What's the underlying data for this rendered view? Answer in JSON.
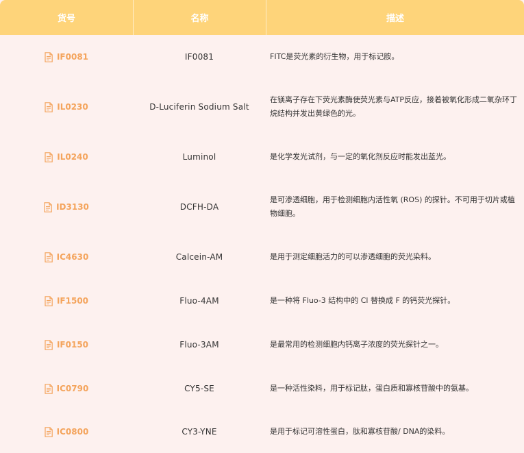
{
  "header": {
    "col_code": "货号",
    "col_name": "名称",
    "col_desc": "描述"
  },
  "colors": {
    "header_bg": "#fed47a",
    "body_bg": "#fdf1ef",
    "code_accent": "#f4a45c"
  },
  "rows": [
    {
      "code": "IF0081",
      "name": "IF0081",
      "desc": "FITC是荧光素的衍生物，用于标记胺。",
      "icon": "document-icon"
    },
    {
      "code": "IL0230",
      "name": "D-Luciferin Sodium Salt",
      "desc": "在镁离子存在下荧光素酶使荧光素与ATP反应，接着被氧化形成二氧杂环丁烷结构并发出黄绿色的光。",
      "icon": "document-icon"
    },
    {
      "code": "IL0240",
      "name": "Luminol",
      "desc": "是化学发光试剂，与一定的氧化剂反应时能发出蓝光。",
      "icon": "document-icon"
    },
    {
      "code": "ID3130",
      "name": "DCFH-DA",
      "desc": "是可渗透细胞，用于检测细胞内活性氧 (ROS) 的探针。不可用于切片或植物细胞。",
      "icon": "document-icon"
    },
    {
      "code": "IC4630",
      "name": "Calcein-AM",
      "desc": "是用于测定细胞活力的可以渗透细胞的荧光染料。",
      "icon": "document-icon"
    },
    {
      "code": "IF1500",
      "name": "Fluo-4AM",
      "desc": "是一种将 Fluo-3 结构中的 Cl 替换成 F 的钙荧光探针。",
      "icon": "document-icon"
    },
    {
      "code": "IF0150",
      "name": "Fluo-3AM",
      "desc": "是最常用的检测细胞内钙离子浓度的荧光探针之一。",
      "icon": "document-icon"
    },
    {
      "code": "IC0790",
      "name": "CY5-SE",
      "desc": "是一种活性染料，用于标记肽，蛋白质和寡核苷酸中的氨基。",
      "icon": "document-icon"
    },
    {
      "code": "IC0800",
      "name": "CY3-YNE",
      "desc": "是用于标记可溶性蛋白，肽和寡核苷酸/ DNA的染料。",
      "icon": "document-icon"
    }
  ]
}
